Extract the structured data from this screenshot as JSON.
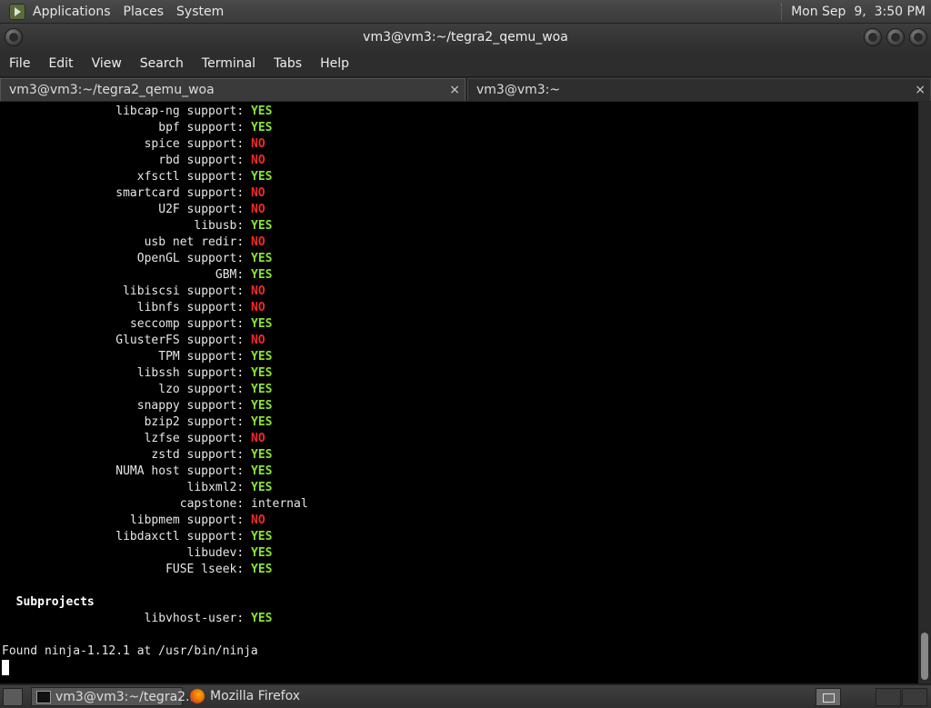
{
  "top_panel": {
    "menus": [
      "Applications",
      "Places",
      "System"
    ],
    "clock": "Mon Sep  9,  3:50 PM"
  },
  "window": {
    "title": "vm3@vm3:~/tegra2_qemu_woa",
    "menu": [
      "File",
      "Edit",
      "View",
      "Search",
      "Terminal",
      "Tabs",
      "Help"
    ]
  },
  "tabs": [
    {
      "label": "vm3@vm3:~/tegra2_qemu_woa",
      "close": "×"
    },
    {
      "label": "vm3@vm3:~",
      "close": "×"
    }
  ],
  "terminal": {
    "features": [
      {
        "label": "libcap-ng support:",
        "value": "YES"
      },
      {
        "label": "bpf support:",
        "value": "YES"
      },
      {
        "label": "spice support:",
        "value": "NO"
      },
      {
        "label": "rbd support:",
        "value": "NO"
      },
      {
        "label": "xfsctl support:",
        "value": "YES"
      },
      {
        "label": "smartcard support:",
        "value": "NO"
      },
      {
        "label": "U2F support:",
        "value": "NO"
      },
      {
        "label": "libusb:",
        "value": "YES"
      },
      {
        "label": "usb net redir:",
        "value": "NO"
      },
      {
        "label": "OpenGL support:",
        "value": "YES"
      },
      {
        "label": "GBM:",
        "value": "YES"
      },
      {
        "label": "libiscsi support:",
        "value": "NO"
      },
      {
        "label": "libnfs support:",
        "value": "NO"
      },
      {
        "label": "seccomp support:",
        "value": "YES"
      },
      {
        "label": "GlusterFS support:",
        "value": "NO"
      },
      {
        "label": "TPM support:",
        "value": "YES"
      },
      {
        "label": "libssh support:",
        "value": "YES"
      },
      {
        "label": "lzo support:",
        "value": "YES"
      },
      {
        "label": "snappy support:",
        "value": "YES"
      },
      {
        "label": "bzip2 support:",
        "value": "YES"
      },
      {
        "label": "lzfse support:",
        "value": "NO"
      },
      {
        "label": "zstd support:",
        "value": "YES"
      },
      {
        "label": "NUMA host support:",
        "value": "YES"
      },
      {
        "label": "libxml2:",
        "value": "YES"
      },
      {
        "label": "capstone:",
        "value": "internal"
      },
      {
        "label": "libpmem support:",
        "value": "NO"
      },
      {
        "label": "libdaxctl support:",
        "value": "YES"
      },
      {
        "label": "libudev:",
        "value": "YES"
      },
      {
        "label": "FUSE lseek:",
        "value": "YES"
      }
    ],
    "subprojects_heading": "Subprojects",
    "subprojects": [
      {
        "label": "libvhost-user:",
        "value": "YES"
      }
    ],
    "found_line": "Found ninja-1.12.1 at /usr/bin/ninja"
  },
  "taskbar": {
    "items": [
      {
        "label": "vm3@vm3:~/tegra2...",
        "icon": "terminal-icon"
      },
      {
        "label": "Mozilla Firefox",
        "icon": "firefox-icon"
      }
    ]
  },
  "colors": {
    "yes": "#8ae234",
    "no": "#ef2929"
  }
}
